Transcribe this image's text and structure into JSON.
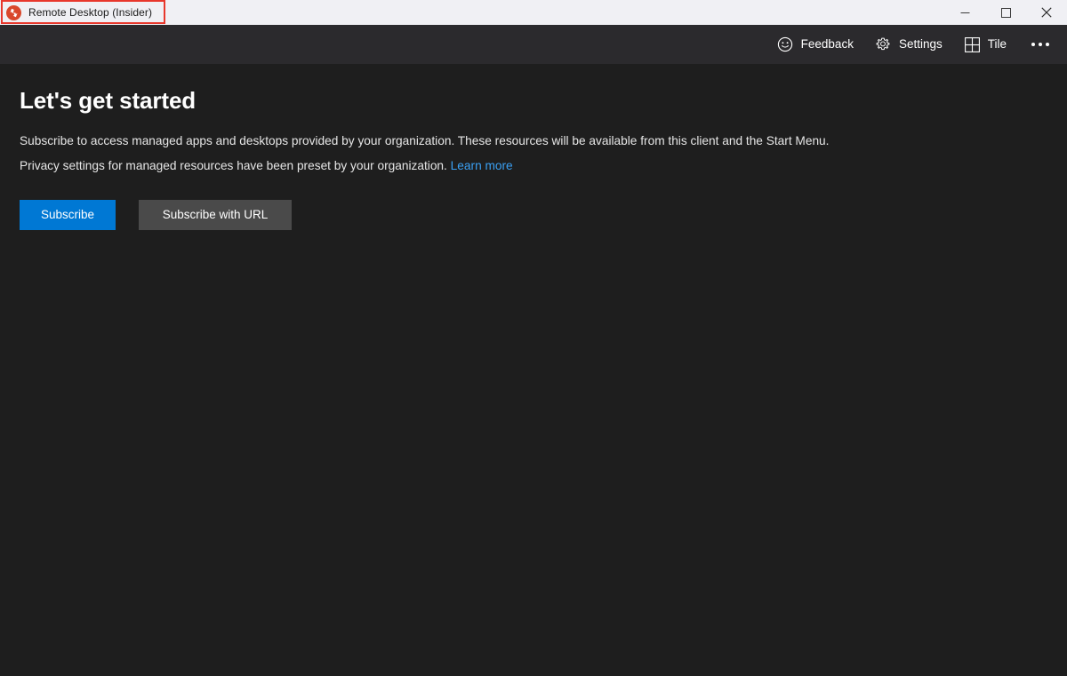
{
  "window": {
    "title": "Remote Desktop (Insider)",
    "app_icon": "remote-desktop-icon",
    "controls": {
      "minimize": "minimize-icon",
      "maximize": "maximize-icon",
      "close": "close-icon"
    },
    "highlight_color": "#e8372c",
    "titlebar_bg": "#f0f0f4"
  },
  "toolbar": {
    "items": [
      {
        "label": "Feedback",
        "icon": "smiley-face-icon"
      },
      {
        "label": "Settings",
        "icon": "gear-icon"
      },
      {
        "label": "Tile",
        "icon": "grid-tile-icon"
      }
    ],
    "more": "ellipsis-icon",
    "bg": "#2b2a2d"
  },
  "main": {
    "title": "Let's get started",
    "paragraph1": "Subscribe to access managed apps and desktops provided by your organization. These resources will be available from this client and the Start Menu.",
    "paragraph2_text": "Privacy settings for managed resources have been preset by your organization.",
    "paragraph2_link": "Learn more",
    "buttons": {
      "primary": "Subscribe",
      "secondary": "Subscribe with URL"
    },
    "colors": {
      "accent": "#0078d4",
      "secondary_button": "#4a4a4a",
      "link": "#3aa0f3",
      "background": "#1e1e1e"
    }
  }
}
